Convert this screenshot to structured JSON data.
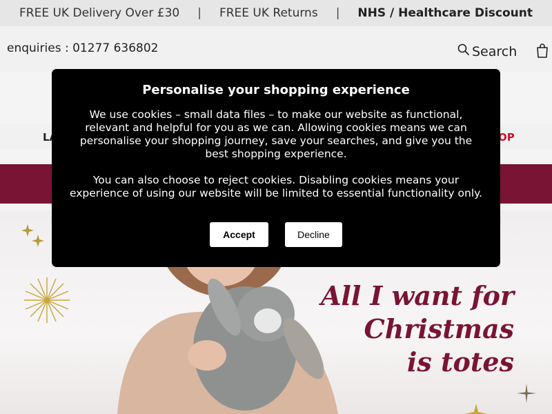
{
  "promo_bar": {
    "item1": "FREE UK Delivery Over £30",
    "sep": "|",
    "item2": "FREE UK Returns",
    "item3": "NHS / Healthcare Discount"
  },
  "header": {
    "enquiries": "enquiries : 01277 636802",
    "search_label": "Search"
  },
  "nav": {
    "left_fragment": "LA",
    "right_fragment": "OP"
  },
  "hero": {
    "line1": "All I want for",
    "line2": "Christmas",
    "line3": "is totes"
  },
  "cookie_modal": {
    "title": "Personalise your shopping experience",
    "paragraph1": "We use cookies – small data files – to make our website as functional, relevant and helpful for you as we can. Allowing cookies means we can personalise your shopping journey, save your searches, and give you the best shopping experience.",
    "paragraph2": "You can also choose to reject cookies. Disabling cookies means your experience of using our website will be limited to essential functionality only.",
    "accept_label": "Accept",
    "decline_label": "Decline"
  },
  "colors": {
    "brand": "#7a1434",
    "accent_red": "#c8102e",
    "modal_bg": "#000000"
  }
}
